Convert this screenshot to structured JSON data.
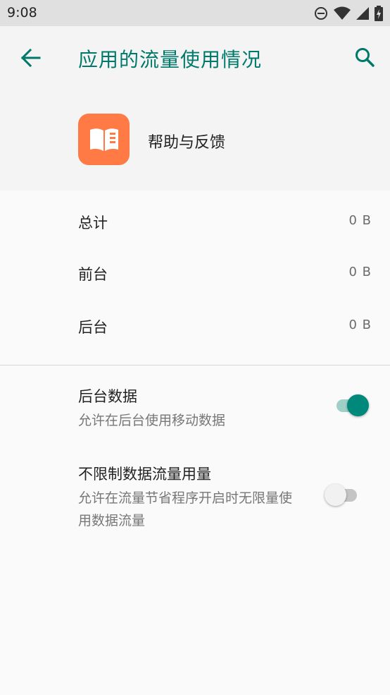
{
  "status_bar": {
    "time": "9:08",
    "icons": [
      "dnd-icon",
      "wifi-icon",
      "signal-icon",
      "battery-icon"
    ]
  },
  "header": {
    "title": "应用的流量使用情况"
  },
  "app": {
    "name": "帮助与反馈",
    "icon": "book-icon",
    "icon_color": "#ff7a45"
  },
  "usage": {
    "rows": [
      {
        "label": "总计",
        "value": "0 B"
      },
      {
        "label": "前台",
        "value": "0 B"
      },
      {
        "label": "后台",
        "value": "0 B"
      }
    ]
  },
  "settings": {
    "background_data": {
      "title": "后台数据",
      "subtitle": "允许在后台使用移动数据",
      "enabled": true
    },
    "unrestricted_data": {
      "title": "不限制数据流量用量",
      "subtitle": "允许在流量节省程序开启时无限量使用数据流量",
      "enabled": false
    }
  },
  "colors": {
    "accent": "#00796b",
    "switch_on": "#00897b"
  }
}
